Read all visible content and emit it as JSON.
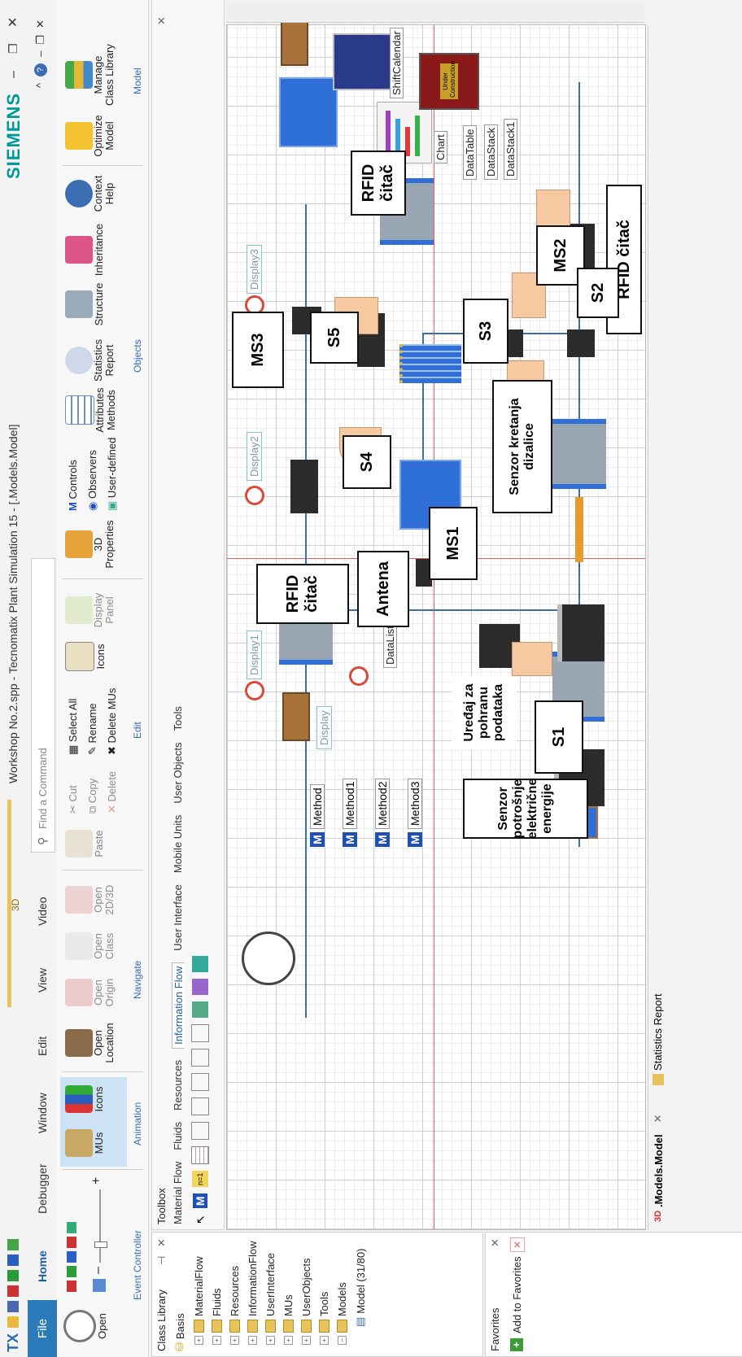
{
  "window": {
    "title": "Workshop No.2.spp - Tecnomatix Plant Simulation 15 - [.Models.Model]",
    "brand": "SIEMENS",
    "app_tag": "TX",
    "ctx_tab": "3D",
    "search_placeholder": "Find a Command",
    "controls": {
      "minimize": "–",
      "restore": "❐",
      "close": "✕"
    }
  },
  "ribbon": {
    "tabs": [
      "File",
      "Home",
      "Debugger",
      "Window",
      "Edit",
      "View",
      "Video"
    ],
    "groups": {
      "event_controller": {
        "label": "Event Controller",
        "open": "Open",
        "minus": "–",
        "plus": "+"
      },
      "animation": {
        "label": "Animation",
        "mus": "MUs",
        "icons": "Icons"
      },
      "navigate": {
        "label": "Navigate",
        "open_location": "Open\nLocation",
        "open_origin": "Open\nOrigin",
        "open_class": "Open\nClass",
        "open_2d3d": "Open\n2D/3D"
      },
      "edit": {
        "label": "Edit",
        "paste": "Paste",
        "cut": "Cut",
        "copy": "Copy",
        "delete": "Delete",
        "select_all": "Select All",
        "rename": "Rename",
        "delete_mus": "Delete MUs",
        "icons": "Icons",
        "display_panel": "Display\nPanel"
      },
      "objects": {
        "label": "Objects",
        "properties_3d": "3D\nProperties",
        "controls": "Controls",
        "observers": "Observers",
        "user_defined": "User-defined",
        "attributes_methods": "Attributes\nMethods",
        "statistics_report": "Statistics\nReport",
        "structure": "Structure",
        "inheritance": "Inheritance",
        "context_help": "Context\nHelp"
      },
      "model": {
        "label": "Model",
        "optimize_model": "Optimize\nModel",
        "manage_class_library": "Manage\nClass Library"
      }
    }
  },
  "class_library": {
    "title": "Class Library",
    "pin": "⊣",
    "close": "✕",
    "items": [
      {
        "label": "Basis",
        "level": 0
      },
      {
        "label": "MaterialFlow",
        "level": 1
      },
      {
        "label": "Fluids",
        "level": 1
      },
      {
        "label": "Resources",
        "level": 1
      },
      {
        "label": "InformationFlow",
        "level": 1
      },
      {
        "label": "UserInterface",
        "level": 1
      },
      {
        "label": "MUs",
        "level": 1
      },
      {
        "label": "UserObjects",
        "level": 1
      },
      {
        "label": "Tools",
        "level": 1
      },
      {
        "label": "Models",
        "level": 1
      },
      {
        "label": "Model (31/80)",
        "level": 2
      }
    ]
  },
  "favorites": {
    "title": "Favorites",
    "add": "Add to Favorites",
    "close": "✕"
  },
  "toolbox": {
    "title": "Toolbox",
    "tabs": [
      "Material Flow",
      "Fluids",
      "Resources",
      "Information Flow",
      "User Interface",
      "Mobile Units",
      "User Objects",
      "Tools"
    ],
    "active_tab": "Information Flow"
  },
  "doc_tabs": {
    "model": ".Models.Model",
    "stats": "Statistics Report",
    "close": "✕"
  },
  "model": {
    "methods": [
      "Method",
      "Method1",
      "Method2",
      "Method3"
    ],
    "displays": [
      "Display1",
      "Display",
      "Display2",
      "Display3"
    ],
    "datalist": "DataList",
    "chart": "Chart",
    "datatable": "DataTable",
    "datastack": "DataStack",
    "datastack1": "DataStack1",
    "shiftcalendar": "ShiftCalendar",
    "under_construction": "Under Construction"
  },
  "annotations": {
    "rfid_1": "RFID čitač",
    "rfid_2": "RFID čitač",
    "rfid_3": "RFID čitač",
    "antena": "Antena",
    "ms1": "MS1",
    "ms2": "MS2",
    "ms3": "MS3",
    "s1": "S1",
    "s2": "S2",
    "s3": "S3",
    "s4": "S4",
    "s5": "S5",
    "storage": "Uređaj za pohranu podataka",
    "energy": "Senzor potrošnje električne energije",
    "crane": "Senzor kretanja dizalice"
  },
  "colors": {
    "accent": "#2b6cb0",
    "file_tab": "#2b7bb9",
    "block_blue": "#2f6fd8",
    "arrow_peach": "#f7c9a1"
  }
}
